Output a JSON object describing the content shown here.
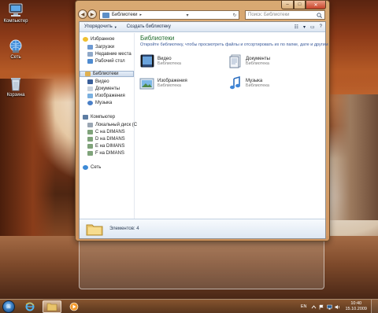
{
  "desktop": {
    "icons": [
      {
        "label": "Компьютер",
        "icon": "computer-icon"
      },
      {
        "label": "Сеть",
        "icon": "network-icon"
      },
      {
        "label": "Корзина",
        "icon": "recycle-bin-icon"
      }
    ]
  },
  "window": {
    "address": {
      "path": "Библиотеки",
      "arrow_glyph": "▸"
    },
    "search": {
      "placeholder": "Поиск: Библиотеки",
      "icon": "search-icon"
    },
    "caption_buttons": {
      "minimize": "–",
      "maximize": "□",
      "close": "✕"
    },
    "nav_glyphs": {
      "back": "◀",
      "forward": "▶",
      "refresh": "↻",
      "dropdown": "▾"
    },
    "toolbar": {
      "organize": "Упорядочить",
      "new_library": "Создать библиотеку",
      "caret": "▼",
      "view_glyph": "☷",
      "view_caret": "▾",
      "preview_glyph": "▭",
      "help_glyph": "?"
    },
    "nav_pane": {
      "favorites_header": "Избранное",
      "favorites": [
        "Загрузки",
        "Недавние места",
        "Рабочий стол"
      ],
      "libraries_header": "Библиотеки",
      "libraries": [
        "Видео",
        "Документы",
        "Изображения",
        "Музыка"
      ],
      "computer_header": "Компьютер",
      "drives": [
        "Локальный диск (C",
        "C на DIMANS",
        "D на DIMANS",
        "E на DIMANS",
        "F на DIMANS"
      ],
      "network": "Сеть"
    },
    "main": {
      "title": "Библиотеки",
      "description": "Откройте библиотеку, чтобы просмотреть файлы и отсортировать их по папке, дате и другим",
      "tiles": [
        {
          "name": "Видео",
          "kind": "Библиотека",
          "icon": "video-library-icon"
        },
        {
          "name": "Документы",
          "kind": "Библиотека",
          "icon": "documents-library-icon"
        },
        {
          "name": "Изображения",
          "kind": "Библиотека",
          "icon": "pictures-library-icon"
        },
        {
          "name": "Музыка",
          "kind": "Библиотека",
          "icon": "music-library-icon"
        }
      ]
    },
    "details": {
      "text": "Элементов: 4"
    }
  },
  "taskbar": {
    "start_glyph": "⊞",
    "lang": "EN",
    "time": "10:40",
    "date": "15.10.2009"
  }
}
